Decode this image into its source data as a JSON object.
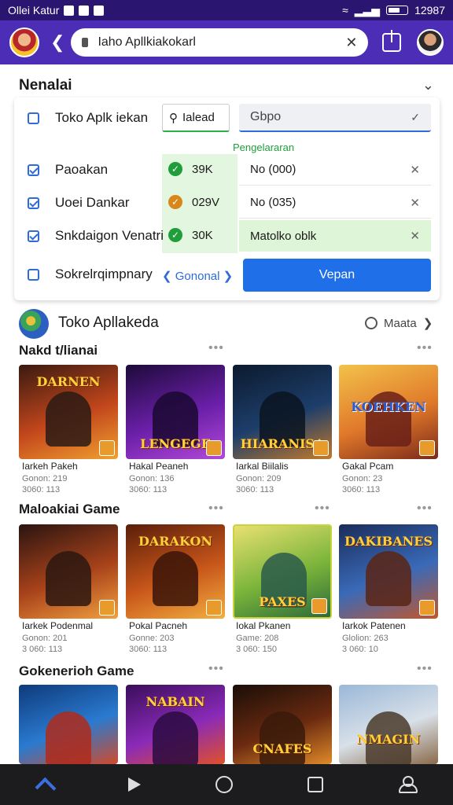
{
  "status": {
    "carrier": "Ollei Katur",
    "time": "12987"
  },
  "header": {
    "url": "Iaho Apllkiakokarl"
  },
  "settings": {
    "title": "Nenalai",
    "column_header": "Pengelararan",
    "rows": [
      {
        "label": "Toko Aplk iekan",
        "checked": false
      },
      {
        "label": "Paoakan",
        "checked": true
      },
      {
        "label": "Uoei Dankar",
        "checked": true
      },
      {
        "label": "Snkdaigon Venatri",
        "checked": true
      },
      {
        "label": "Sokrelrqimpnary",
        "checked": false
      }
    ],
    "search_value": "Ialead",
    "input_value": "Gbpo",
    "values": [
      {
        "icon": "check-circle-icon",
        "text": "39K"
      },
      {
        "icon": "warning-circle-icon",
        "text": "029V"
      },
      {
        "icon": "check-circle-icon",
        "text": "30K"
      }
    ],
    "outputs": [
      {
        "text": "No (000)"
      },
      {
        "text": "No (035)"
      },
      {
        "text": "Matolko oblk"
      }
    ],
    "link": "Gononal",
    "button": "Vepan"
  },
  "store": {
    "title": "Toko Apllakeda",
    "more": "Maata",
    "sections": [
      {
        "title": "Nakd t/lianai",
        "games": [
          {
            "logo": "DARNEN",
            "name": "Iarkeh Pakeh",
            "line1": "Gonon: 219",
            "line2": "3060: 113"
          },
          {
            "logo": "LENGEGE",
            "name": "Hakal Peaneh",
            "line1": "Gonon: 136",
            "line2": "3060: 113"
          },
          {
            "logo": "HIARANISA",
            "name": "Iarkal Biilalis",
            "line1": "Gonon: 209",
            "line2": "3060: 113"
          },
          {
            "logo": "KOEHKEN",
            "name": "Gakal Pcam",
            "line1": "Gonon: 23",
            "line2": "3060: 113"
          }
        ]
      },
      {
        "title": "Maloakiai Game",
        "games": [
          {
            "logo": "",
            "name": "Iarkek Podenmal",
            "line1": "Gonon: 201",
            "line2": "3 060: 113"
          },
          {
            "logo": "DARAKON",
            "name": "Pokal Pacneh",
            "line1": "Gonne: 203",
            "line2": "3060: 113"
          },
          {
            "logo": "PAXES",
            "name": "Iokal Pkanen",
            "line1": "Game: 208",
            "line2": "3 060: 150"
          },
          {
            "logo": "DAKIBANES",
            "name": "Iarkok Patenen",
            "line1": "Glolion: 263",
            "line2": "3 060: 10"
          }
        ]
      },
      {
        "title": "Gokenerioh Game",
        "games": [
          {
            "logo": "",
            "name": "",
            "line1": "",
            "line2": ""
          },
          {
            "logo": "NABAIN",
            "name": "",
            "line1": "",
            "line2": ""
          },
          {
            "logo": "CNAFES",
            "name": "",
            "line1": "",
            "line2": ""
          },
          {
            "logo": "NMAGIN",
            "name": "",
            "line1": "",
            "line2": ""
          }
        ]
      }
    ]
  },
  "colors": {
    "header": "#4b2eb5",
    "statusbar": "#2a1670",
    "accent": "#1f6fe8",
    "success": "#1f9e3b"
  }
}
